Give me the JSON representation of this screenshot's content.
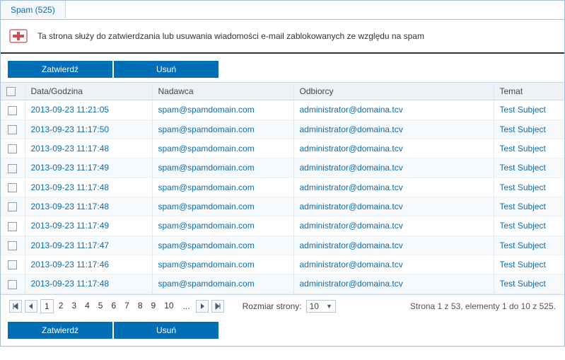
{
  "tab": {
    "label": "Spam (525)"
  },
  "info": {
    "text": "Ta strona służy do zatwierdzania lub usuwania wiadomości e-mail zablokowanych ze względu na spam"
  },
  "buttons": {
    "approve": "Zatwierdź",
    "delete": "Usuń"
  },
  "columns": {
    "datetime": "Data/Godzina",
    "sender": "Nadawca",
    "recipients": "Odbiorcy",
    "subject": "Temat"
  },
  "rows": [
    {
      "datetime": "2013-09-23 11:21:05",
      "sender": "spam@spamdomain.com",
      "recipients": "administrator@domaina.tcv",
      "subject": "Test Subject"
    },
    {
      "datetime": "2013-09-23 11:17:50",
      "sender": "spam@spamdomain.com",
      "recipients": "administrator@domaina.tcv",
      "subject": "Test Subject"
    },
    {
      "datetime": "2013-09-23 11:17:48",
      "sender": "spam@spamdomain.com",
      "recipients": "administrator@domaina.tcv",
      "subject": "Test Subject"
    },
    {
      "datetime": "2013-09-23 11:17:49",
      "sender": "spam@spamdomain.com",
      "recipients": "administrator@domaina.tcv",
      "subject": "Test Subject"
    },
    {
      "datetime": "2013-09-23 11:17:48",
      "sender": "spam@spamdomain.com",
      "recipients": "administrator@domaina.tcv",
      "subject": "Test Subject"
    },
    {
      "datetime": "2013-09-23 11:17:48",
      "sender": "spam@spamdomain.com",
      "recipients": "administrator@domaina.tcv",
      "subject": "Test Subject"
    },
    {
      "datetime": "2013-09-23 11:17:49",
      "sender": "spam@spamdomain.com",
      "recipients": "administrator@domaina.tcv",
      "subject": "Test Subject"
    },
    {
      "datetime": "2013-09-23 11:17:47",
      "sender": "spam@spamdomain.com",
      "recipients": "administrator@domaina.tcv",
      "subject": "Test Subject"
    },
    {
      "datetime": "2013-09-23 11:17:46",
      "sender": "spam@spamdomain.com",
      "recipients": "administrator@domaina.tcv",
      "subject": "Test Subject"
    },
    {
      "datetime": "2013-09-23 11:17:48",
      "sender": "spam@spamdomain.com",
      "recipients": "administrator@domaina.tcv",
      "subject": "Test Subject"
    }
  ],
  "pager": {
    "pages": [
      "1",
      "2",
      "3",
      "4",
      "5",
      "6",
      "7",
      "8",
      "9",
      "10"
    ],
    "ellipsis": "...",
    "page_size_label": "Rozmiar strony:",
    "page_size_value": "10",
    "summary": "Strona 1 z 53, elementy 1 do 10 z 525."
  }
}
